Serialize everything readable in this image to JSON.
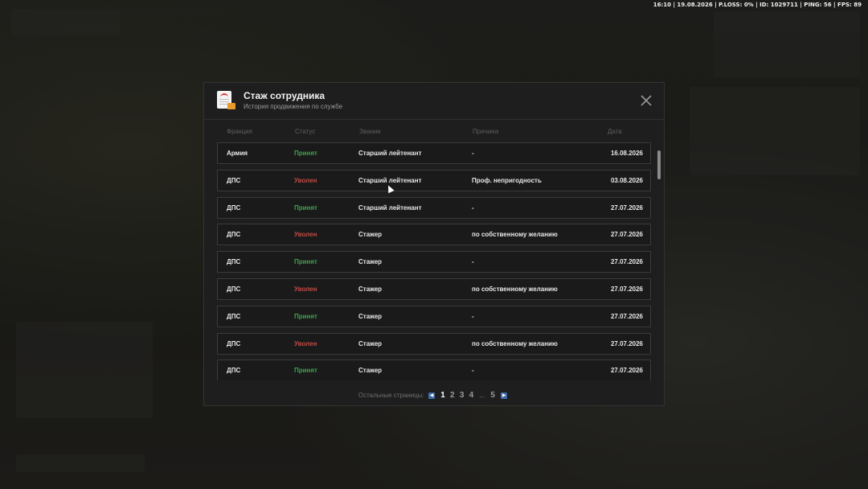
{
  "status_bar": {
    "text": "16:10 | 19.08.2026 | P.LOSS: 0% | ID: 1029711 | PING: 56 | FPS: 89"
  },
  "modal": {
    "title": "Стаж сотрудника",
    "subtitle": "История продвижения по службе",
    "icon": "document-icon",
    "close_icon": "close-icon"
  },
  "table": {
    "headers": {
      "faction": "Фракция",
      "status": "Статус",
      "rank": "Звание",
      "reason": "Причина",
      "date": "Дата"
    },
    "rows": [
      {
        "faction": "Армия",
        "status": "Принят",
        "status_type": "accepted",
        "rank": "Старший лейтенант",
        "reason": "-",
        "date": "16.08.2026"
      },
      {
        "faction": "ДПС",
        "status": "Уволен",
        "status_type": "fired",
        "rank": "Старший лейтенант",
        "reason": "Проф. непригодность",
        "date": "03.08.2026"
      },
      {
        "faction": "ДПС",
        "status": "Принят",
        "status_type": "accepted",
        "rank": "Старший лейтенант",
        "reason": "-",
        "date": "27.07.2026"
      },
      {
        "faction": "ДПС",
        "status": "Уволен",
        "status_type": "fired",
        "rank": "Стажер",
        "reason": "по собственному желанию",
        "date": "27.07.2026"
      },
      {
        "faction": "ДПС",
        "status": "Принят",
        "status_type": "accepted",
        "rank": "Стажер",
        "reason": "-",
        "date": "27.07.2026"
      },
      {
        "faction": "ДПС",
        "status": "Уволен",
        "status_type": "fired",
        "rank": "Стажер",
        "reason": "по собственному желанию",
        "date": "27.07.2026"
      },
      {
        "faction": "ДПС",
        "status": "Принят",
        "status_type": "accepted",
        "rank": "Стажер",
        "reason": "-",
        "date": "27.07.2026"
      },
      {
        "faction": "ДПС",
        "status": "Уволен",
        "status_type": "fired",
        "rank": "Стажер",
        "reason": "по собственному желанию",
        "date": "27.07.2026"
      },
      {
        "faction": "ДПС",
        "status": "Принят",
        "status_type": "accepted",
        "rank": "Стажер",
        "reason": "-",
        "date": "27.07.2026"
      }
    ]
  },
  "pagination": {
    "label": "Остальные страницы:",
    "pages": [
      "1",
      "2",
      "3",
      "4"
    ],
    "active_page": "1",
    "ellipsis": "...",
    "last_page": "5",
    "prev_icon": "chevron-left-icon",
    "next_icon": "chevron-right-icon"
  },
  "colors": {
    "accepted": "#3fa34d",
    "fired": "#c24a44",
    "accent": "#3e6aa8"
  }
}
